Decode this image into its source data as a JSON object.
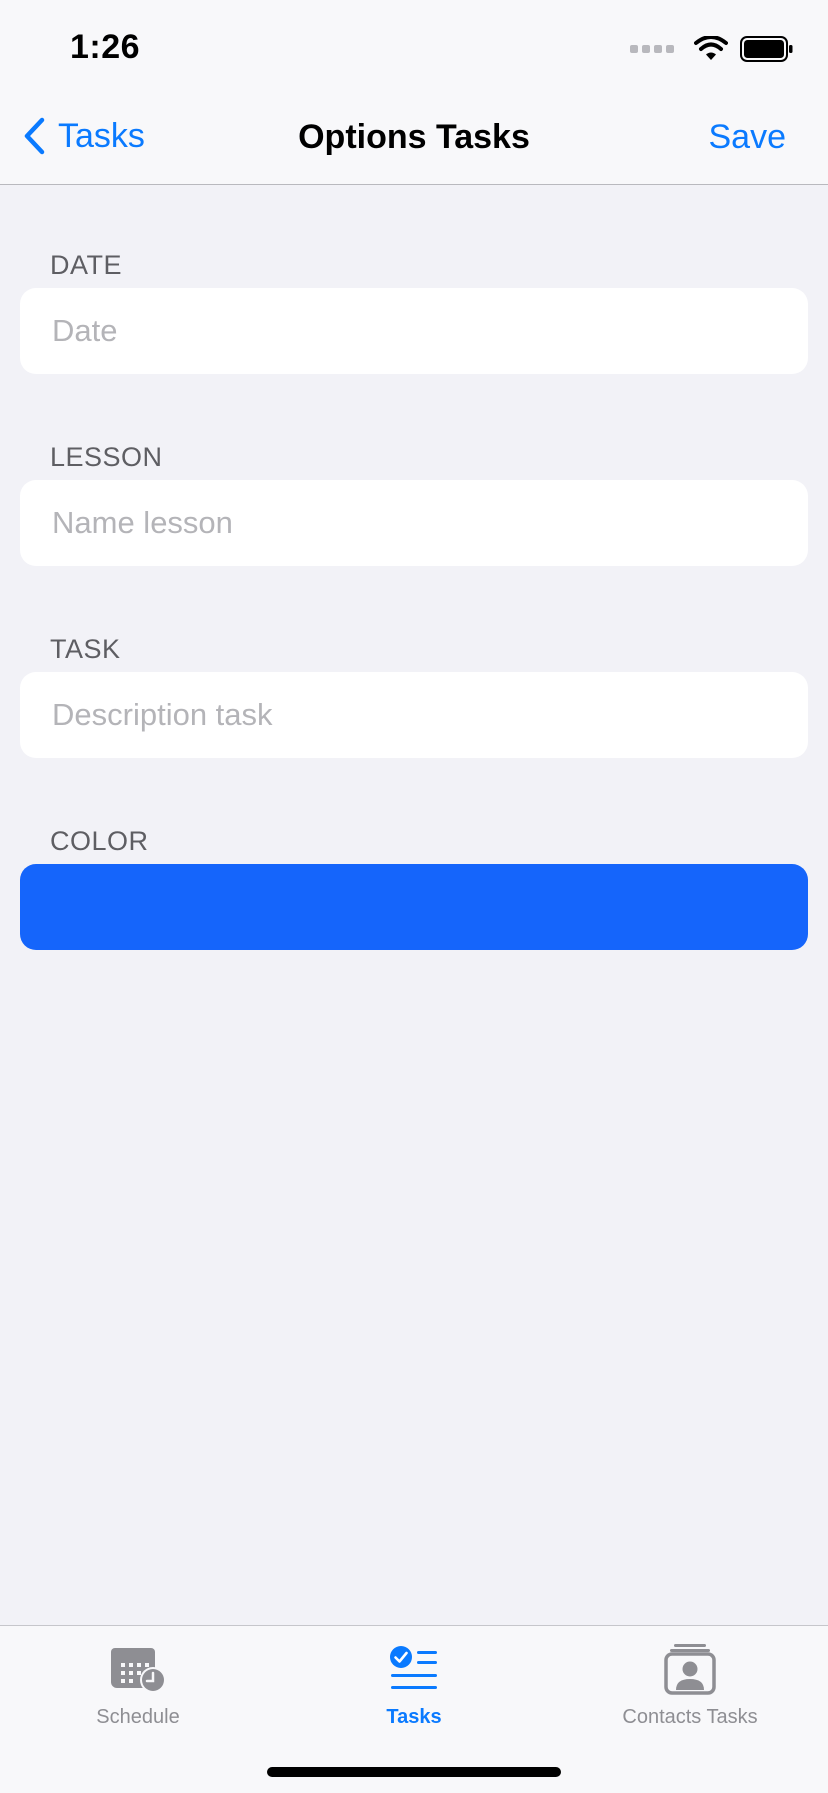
{
  "status": {
    "time": "1:26"
  },
  "nav": {
    "back_label": "Tasks",
    "title": "Options Tasks",
    "save_label": "Save"
  },
  "form": {
    "date": {
      "label": "DATE",
      "placeholder": "Date"
    },
    "lesson": {
      "label": "LESSON",
      "placeholder": "Name lesson"
    },
    "task": {
      "label": "TASK",
      "placeholder": "Description task"
    },
    "color": {
      "label": "COLOR",
      "value": "#1565FB"
    }
  },
  "tabs": [
    {
      "label": "Schedule",
      "icon": "calendar-clock-icon",
      "active": false
    },
    {
      "label": "Tasks",
      "icon": "checklist-icon",
      "active": true
    },
    {
      "label": "Contacts Tasks",
      "icon": "contact-card-icon",
      "active": false
    }
  ],
  "colors": {
    "accent": "#0A7AFF",
    "inactive": "#8E8E93",
    "background": "#F2F2F7"
  }
}
